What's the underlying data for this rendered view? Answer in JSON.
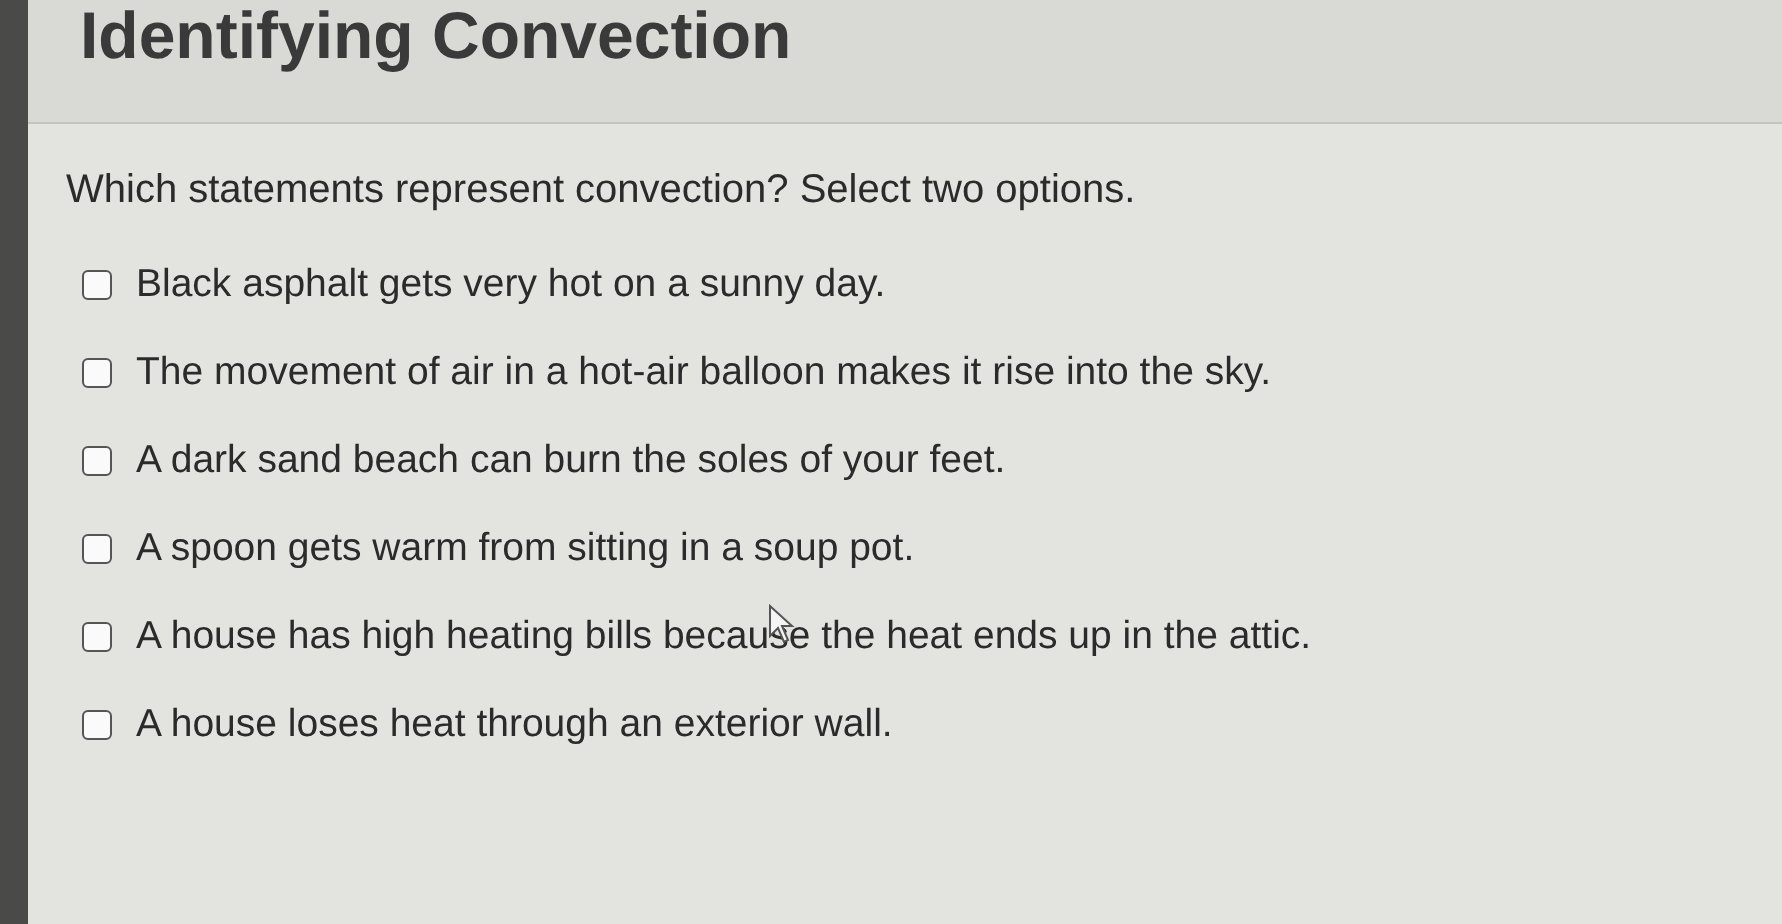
{
  "title": "Identifying Convection",
  "question": "Which statements represent convection? Select two options.",
  "options": [
    {
      "label": "Black asphalt gets very hot on a sunny day.",
      "checked": false
    },
    {
      "label": "The movement of air in a hot-air balloon makes it rise into the sky.",
      "checked": false
    },
    {
      "label": "A dark sand beach can burn the soles of your feet.",
      "checked": false
    },
    {
      "label": "A spoon gets warm from sitting in a soup pot.",
      "checked": false
    },
    {
      "label": "A house has high heating bills because the heat ends up in the attic.",
      "checked": false
    },
    {
      "label": "A house loses heat through an exterior wall.",
      "checked": false
    }
  ]
}
